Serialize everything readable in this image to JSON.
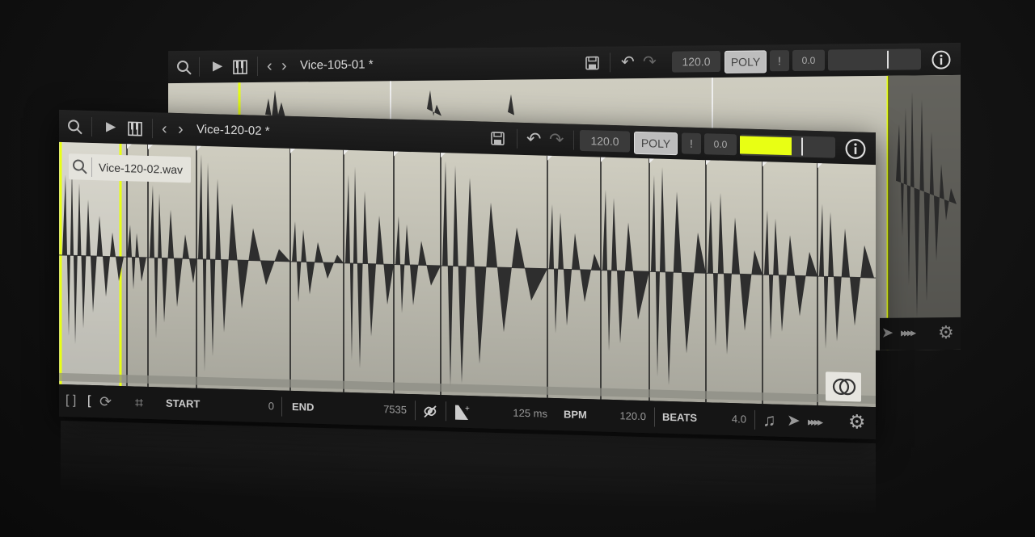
{
  "back_window": {
    "title": "Vice-105-01 *",
    "bpm": "120.0",
    "poly_label": "POLY",
    "alert_label": "!",
    "gain": "0.0"
  },
  "front_window": {
    "title": "Vice-120-02 *",
    "bpm": "120.0",
    "poly_label": "POLY",
    "alert_label": "!",
    "gain": "0.0",
    "file_name": "Vice-120-02.wav",
    "footer": {
      "start_label": "START",
      "start_value": "0",
      "end_label": "END",
      "end_value": "7535",
      "time_value": "125 ms",
      "bpm_label": "BPM",
      "bpm_value": "120.0",
      "beats_label": "BEATS",
      "beats_value": "4.0"
    }
  },
  "colors": {
    "accent": "#e8ff14",
    "waveform": "#2e2e2e",
    "background": "#121212"
  },
  "icons": [
    "search-icon",
    "play-icon",
    "piano-icon",
    "prev-icon",
    "next-icon",
    "save-icon",
    "undo-icon",
    "redo-icon",
    "info-icon",
    "gear-icon",
    "stereo-icon",
    "link-icon",
    "slice-icon",
    "note-icon",
    "arrow-icon"
  ]
}
